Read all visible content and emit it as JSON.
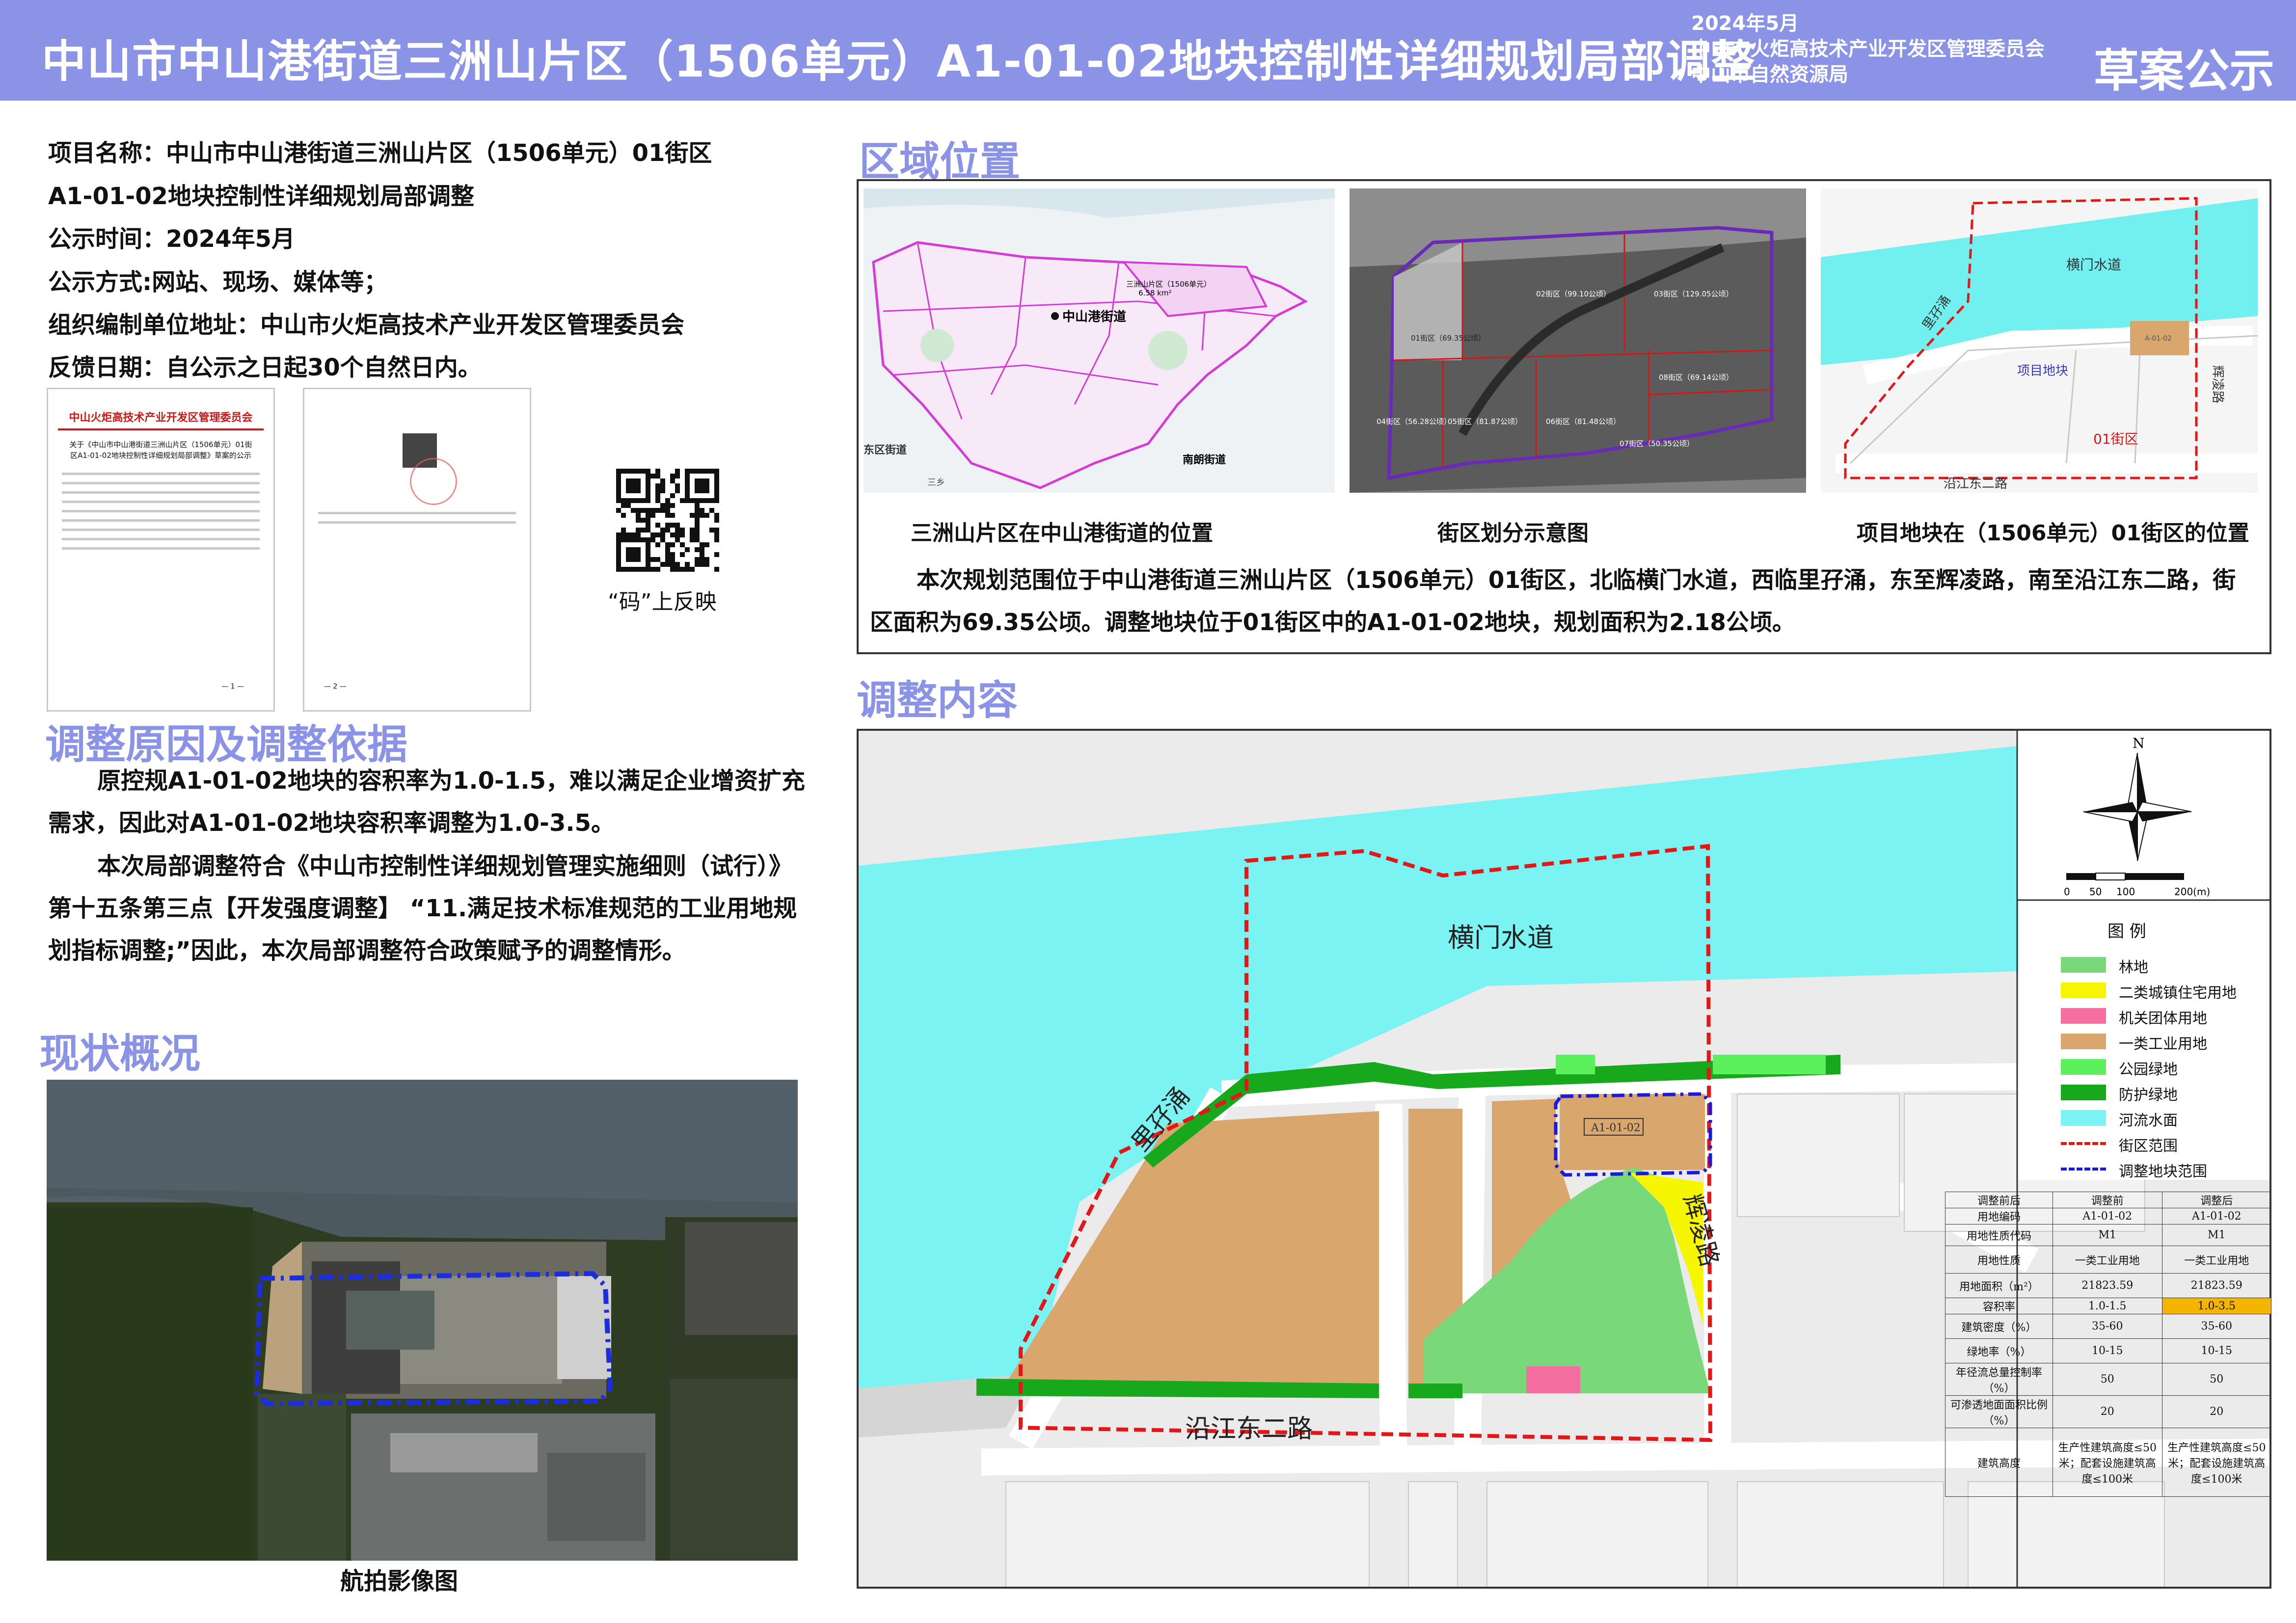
{
  "header": {
    "title": "中山市中山港街道三洲山片区（1506单元）A1-01-02地块控制性详细规划局部调整",
    "date": "2024年5月",
    "org1": "中山市火炬高技术产业开发区管理委员会",
    "org2": "中山市自然资源局",
    "stage": "草案公示"
  },
  "info": {
    "project_line1": "项目名称：中山市中山港街道三洲山片区（1506单元）01街区",
    "project_line2": "A1-01-02地块控制性详细规划局部调整",
    "time": "公示时间：2024年5月",
    "method": "公示方式:网站、现场、媒体等；",
    "org_address": "组织编制单位地址：中山市火炬高技术产业开发区管理委员会",
    "feedback": "反馈日期：自公示之日起30个自然日内。"
  },
  "notice_doc": {
    "header": "中山火炬高技术产业开发区管理委员会",
    "title": "关于《中山市中山港街道三洲山片区（1506单元）01街区A1-01-02地块控制性详细规划局部调整》草案的公示",
    "page1": "— 1 —",
    "page2": "— 2 —"
  },
  "qr_caption": "“码”上反映",
  "sections": {
    "reason_title": "调整原因及调整依据",
    "status_title": "现状概况",
    "location_title": "区域位置",
    "content_title": "调整内容"
  },
  "reason": {
    "para1": "原控规A1-01-02地块的容积率为1.0-1.5，难以满足企业增资扩充需求，因此对A1-01-02地块容积率调整为1.0-3.5。",
    "para2": "本次局部调整符合《中山市控制性详细规划管理实施细则（试行）》第十五条第三点【开发强度调整】 “11.满足技术标准规范的工业用地规划指标调整;”因此，本次局部调整符合政策赋予的调整情形。"
  },
  "aerial_caption": "航拍影像图",
  "location": {
    "map1_caption": "三洲山片区在中山港街道的位置",
    "map2_caption": "街区划分示意图",
    "map3_caption": "项目地块在（1506单元）01街区的位置",
    "description": "本次规划范围位于中山港街道三洲山片区（1506单元）01街区，北临横门水道，西临里孖涌，东至辉凌路，南至沿江东二路，街区面积为69.35公顷。调整地块位于01街区中的A1-01-02地块，规划面积为2.18公顷。",
    "map1_labels": {
      "center": "中山港街道",
      "pianqu": "三洲山片区（1506单元）",
      "area": "6.58 km²",
      "dongqu": "东区街道",
      "nanlang": "南朗街道",
      "sanxiang": "三乡"
    },
    "map2_labels": {
      "d01": "01街区（69.35公顷）",
      "d02": "02街区（99.10公顷）",
      "d03": "03街区（129.05公顷）",
      "d04": "04街区（56.28公顷）",
      "d05": "05街区（81.87公顷）",
      "d06": "06街区（81.48公顷）",
      "d07": "07街区（50.35公顷）",
      "d08": "08街区（69.14公顷）"
    },
    "map3_labels": {
      "river": "横门水道",
      "creek": "里孖涌",
      "site": "项目地块",
      "road_e": "辉凌路",
      "district": "01街区",
      "road_s": "沿江东二路",
      "parcel": "A-01-02"
    }
  },
  "adjust_map": {
    "river": "横门水道",
    "creek": "里孖涌",
    "road_east": "辉凌路",
    "road_south": "沿江东二路",
    "parcel": "A1-01-02",
    "north": "N",
    "scale": [
      "0",
      "50",
      "100",
      "200(m)"
    ]
  },
  "legend": {
    "title": "图    例",
    "items": [
      {
        "label": "林地",
        "color": "#79d879"
      },
      {
        "label": "二类城镇住宅用地",
        "color": "#f6f600"
      },
      {
        "label": "机关团体用地",
        "color": "#f46ea0"
      },
      {
        "label": "一类工业用地",
        "color": "#d9a76e"
      },
      {
        "label": "公园绿地",
        "color": "#5cf05c"
      },
      {
        "label": "防护绿地",
        "color": "#17a81e"
      },
      {
        "label": "河流水面",
        "color": "#7bf3f3"
      },
      {
        "label": "街区范围",
        "color": "#e01818"
      },
      {
        "label": "调整地块范围",
        "color": "#1a1ad8"
      }
    ]
  },
  "param_table": {
    "header": [
      "调整前后",
      "调整前",
      "调整后"
    ],
    "rows": [
      [
        "用地编码",
        "A1-01-02",
        "A1-01-02"
      ],
      [
        "用地性质代码",
        "M1",
        "M1"
      ],
      [
        "用地性质",
        "一类工业用地",
        "一类工业用地"
      ],
      [
        "用地面积（m²）",
        "21823.59",
        "21823.59"
      ],
      [
        "容积率",
        "1.0-1.5",
        "1.0-3.5"
      ],
      [
        "建筑密度（%）",
        "35-60",
        "35-60"
      ],
      [
        "绿地率（%）",
        "10-15",
        "10-15"
      ],
      [
        "年径流总量控制率（%）",
        "50",
        "50"
      ],
      [
        "可渗透地面面积比例（%）",
        "20",
        "20"
      ],
      [
        "建筑高度",
        "生产性建筑高度≤50米；配套设施建筑高度≤100米",
        "生产性建筑高度≤50米；配套设施建筑高度≤100米"
      ]
    ],
    "highlight_color": "#f4b400"
  }
}
